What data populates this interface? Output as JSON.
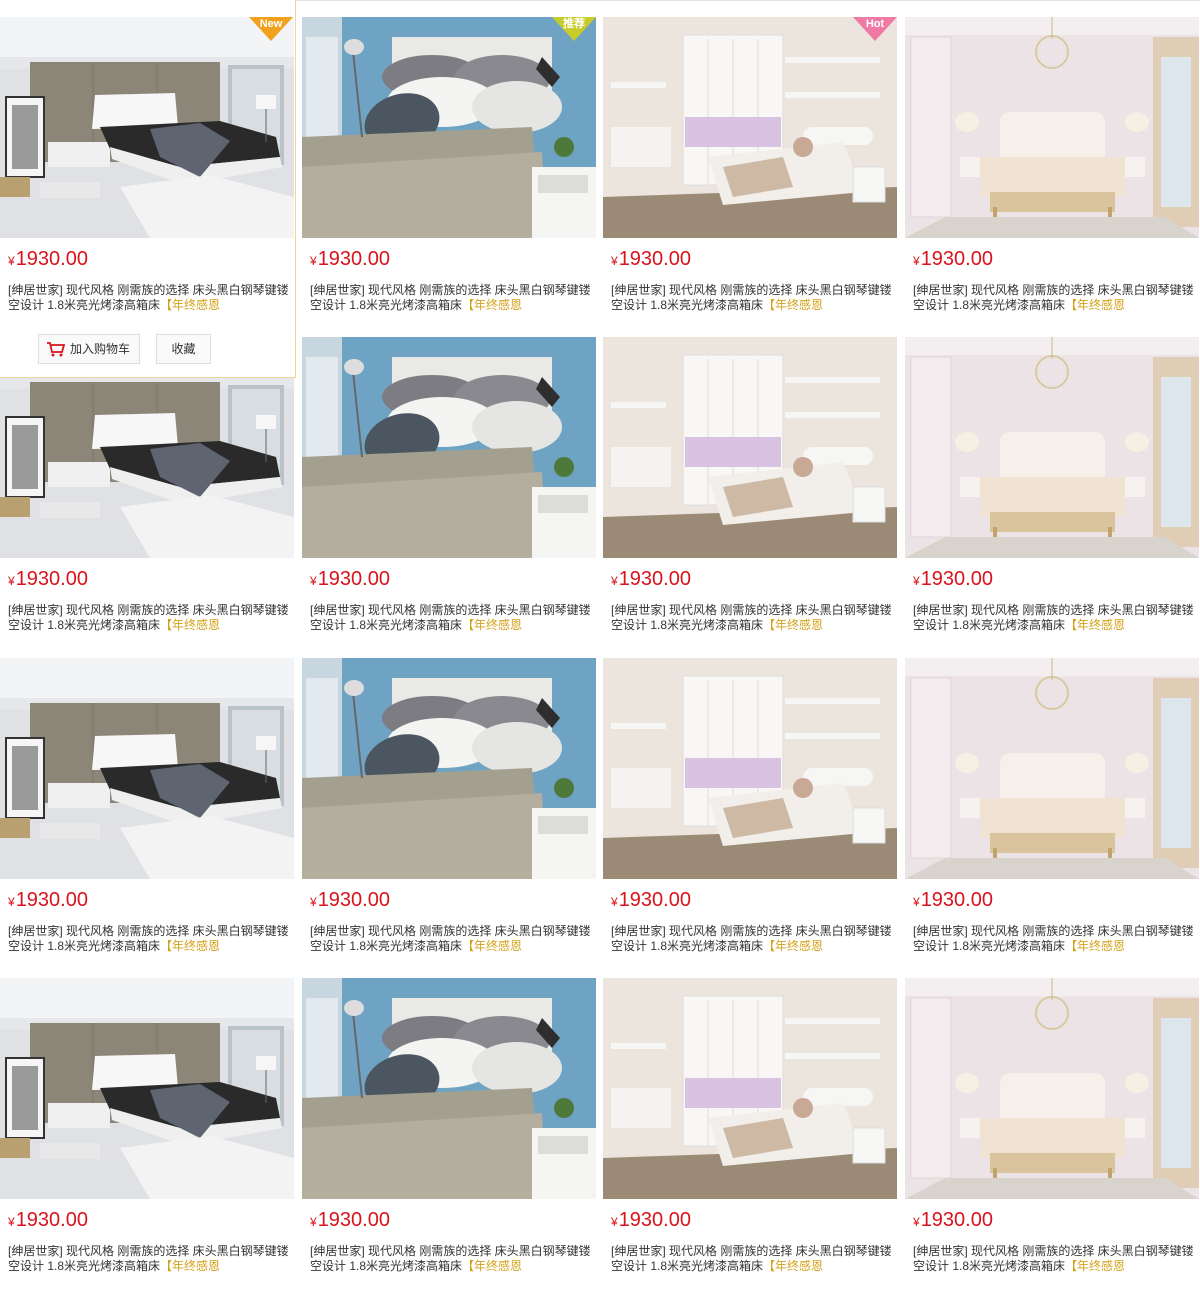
{
  "badges": {
    "new": "New",
    "recommend": "推荐",
    "hot": "Hot"
  },
  "colors": {
    "price": "#d9121c",
    "highlight": "#d4a017",
    "badge_orange": "#f0a21e",
    "badge_pink": "#f07aa6",
    "border_active": "#f0d59c"
  },
  "actions": {
    "cart_label": "加入购物车",
    "favorite_label": "收藏",
    "cart_icon": "shopping-cart-icon"
  },
  "product": {
    "currency": "¥",
    "price": "1930.00",
    "title_main": "[绅居世家] 现代风格 刚需族的选择 床头黑白钢琴键镂空设计 1.8米亮光烤漆高箱床",
    "title_highlight": "【年终感恩"
  },
  "rows": [
    {
      "items": [
        {
          "image": "modern-gray-bedroom",
          "badge": "new",
          "active": true
        },
        {
          "image": "blue-wall-bed-pillows",
          "badge": "recommend"
        },
        {
          "image": "white-kids-bedroom-wardrobe",
          "badge": "hot"
        },
        {
          "image": "classic-pink-bedroom"
        }
      ]
    },
    {
      "items": [
        {
          "image": "modern-gray-bedroom"
        },
        {
          "image": "blue-wall-bed-pillows"
        },
        {
          "image": "white-kids-bedroom-wardrobe"
        },
        {
          "image": "classic-pink-bedroom"
        }
      ]
    },
    {
      "items": [
        {
          "image": "modern-gray-bedroom"
        },
        {
          "image": "blue-wall-bed-pillows"
        },
        {
          "image": "white-kids-bedroom-wardrobe"
        },
        {
          "image": "classic-pink-bedroom"
        }
      ]
    },
    {
      "items": [
        {
          "image": "modern-gray-bedroom"
        },
        {
          "image": "blue-wall-bed-pillows"
        },
        {
          "image": "white-kids-bedroom-wardrobe"
        },
        {
          "image": "classic-pink-bedroom"
        }
      ]
    }
  ]
}
